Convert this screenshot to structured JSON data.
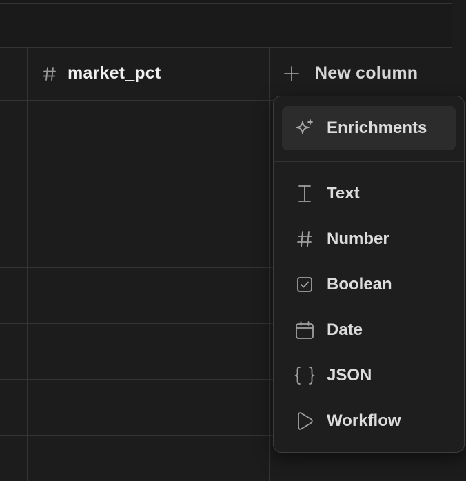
{
  "table": {
    "columns": [
      {
        "icon": "hash-icon",
        "label": "market_pct"
      },
      {
        "icon": "plus-icon",
        "label": "New column"
      }
    ]
  },
  "menu": {
    "featured": {
      "icon": "sparkle-icon",
      "label": "Enrichments"
    },
    "items": [
      {
        "icon": "text-cursor-icon",
        "label": "Text"
      },
      {
        "icon": "hash-icon",
        "label": "Number"
      },
      {
        "icon": "checkbox-icon",
        "label": "Boolean"
      },
      {
        "icon": "calendar-icon",
        "label": "Date"
      },
      {
        "icon": "braces-icon",
        "label": "JSON"
      },
      {
        "icon": "play-icon",
        "label": "Workflow"
      }
    ]
  },
  "colors": {
    "background": "#1c1c1c",
    "grid_line": "#343434",
    "menu_bg": "#1e1e1e",
    "menu_highlight": "#2c2c2c",
    "text": "#dcdcdc",
    "icon": "#a0a0a0"
  }
}
